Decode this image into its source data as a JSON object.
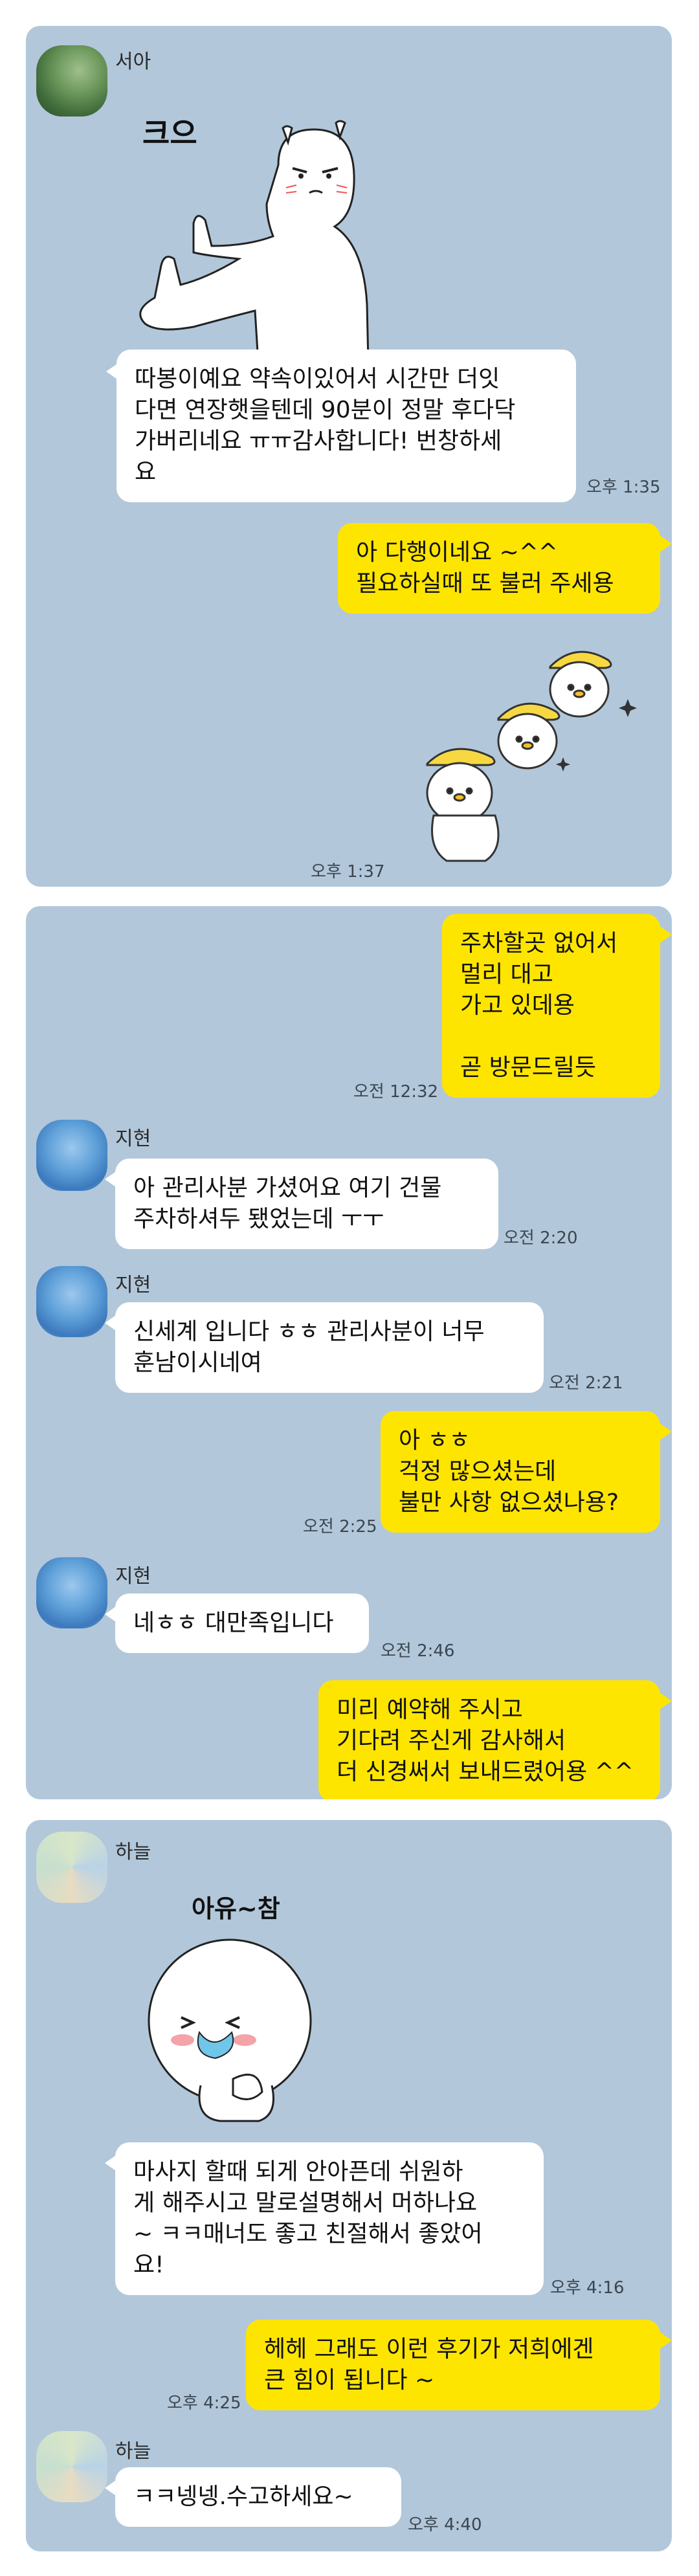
{
  "panel1": {
    "sender": "서아",
    "sticker_text": "크으",
    "received": "따봉이예요 약속이있어서 시간만 더잇\n다면 연장햇을텐데 90분이 정말 후다닥\n가버리네요 ㅠㅠ감사합니다! 번창하세\n요",
    "received_time": "오후 1:35",
    "sent": "아 다행이네요 ~^^\n필요하실때 또 불러 주세용",
    "sent_time": "오후 1:37"
  },
  "panel2": {
    "sent1": "주차할곳 없어서\n멀리 대고\n가고 있데용\n\n곧 방문드릴듯",
    "sent1_time": "오전 12:32",
    "sender": "지현",
    "recv1": "아 관리사분 가셨어요 여기 건물\n주차하셔두 됐었는데 ㅜㅜ",
    "recv1_time": "오전 2:20",
    "recv2": "신세계 입니다 ㅎㅎ 관리사분이 너무\n훈남이시네여",
    "recv2_time": "오전 2:21",
    "sent2": "아 ㅎㅎ\n걱정 많으셨는데\n불만 사항 없으셨나용?",
    "sent2_time": "오전 2:25",
    "recv3": "네ㅎㅎ 대만족입니다",
    "recv3_time": "오전 2:46",
    "sent3": "미리 예약해 주시고\n기다려 주신게 감사해서\n더 신경써서 보내드렸어용 ^^"
  },
  "panel3": {
    "sender": "하늘",
    "sticker_text": "아유~참",
    "recv1": "마사지 할때 되게 안아픈데 쉬원하\n게 해주시고 말로설명해서 머하나요\n~ ㅋㅋ매너도 좋고 친절해서 좋았어\n요!",
    "recv1_time": "오후 4:16",
    "sent": "헤헤 그래도 이런 후기가 저희에겐\n큰 힘이 됩니다 ~",
    "sent_time": "오후 4:25",
    "recv2": "ㅋㅋ넹넹.수고하세요~",
    "recv2_time": "오후 4:40"
  },
  "colors": {
    "chat_bg": "#b2c7da",
    "sent_bubble": "#fee500",
    "received_bubble": "#ffffff"
  }
}
